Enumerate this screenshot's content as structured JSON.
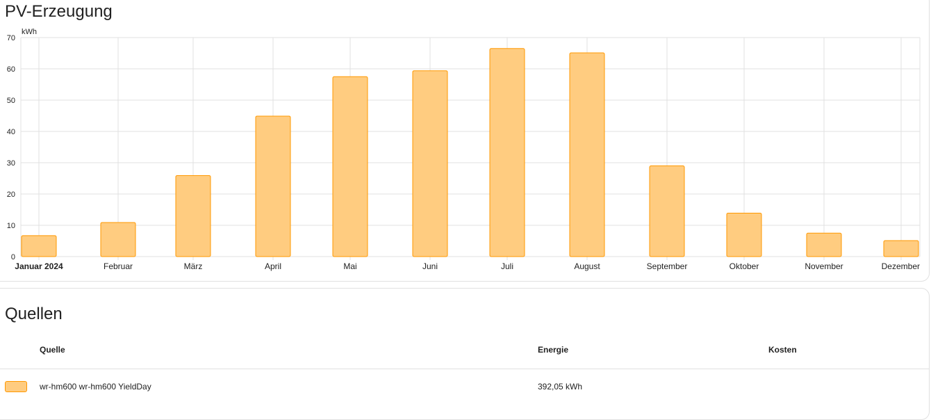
{
  "chart_card": {
    "title": "PV-Erzeugung"
  },
  "chart_data": {
    "type": "bar",
    "unit_label": "kWh",
    "categories": [
      "Januar 2024",
      "Februar",
      "März",
      "April",
      "Mai",
      "Juni",
      "Juli",
      "August",
      "September",
      "Oktober",
      "November",
      "Dezember"
    ],
    "series": [
      {
        "name": "wr-hm600 wr-hm600 YieldDay",
        "values": [
          6.7,
          10.9,
          25.9,
          44.9,
          57.5,
          59.4,
          66.5,
          65.1,
          29.0,
          13.9,
          7.5,
          5.1
        ]
      }
    ],
    "ylim": [
      0,
      70
    ],
    "yticks": [
      0,
      10,
      20,
      30,
      40,
      50,
      60,
      70
    ],
    "grid": true,
    "colors": {
      "fill": "#ffcc80",
      "stroke": "#ff9800",
      "grid": "#e0e0e0"
    }
  },
  "sources_card": {
    "title": "Quellen",
    "headers": {
      "source": "Quelle",
      "energy": "Energie",
      "cost": "Kosten"
    },
    "rows": [
      {
        "source": "wr-hm600 wr-hm600 YieldDay",
        "energy": "392,05 kWh",
        "cost": "",
        "color": "#ffcc80"
      }
    ]
  }
}
